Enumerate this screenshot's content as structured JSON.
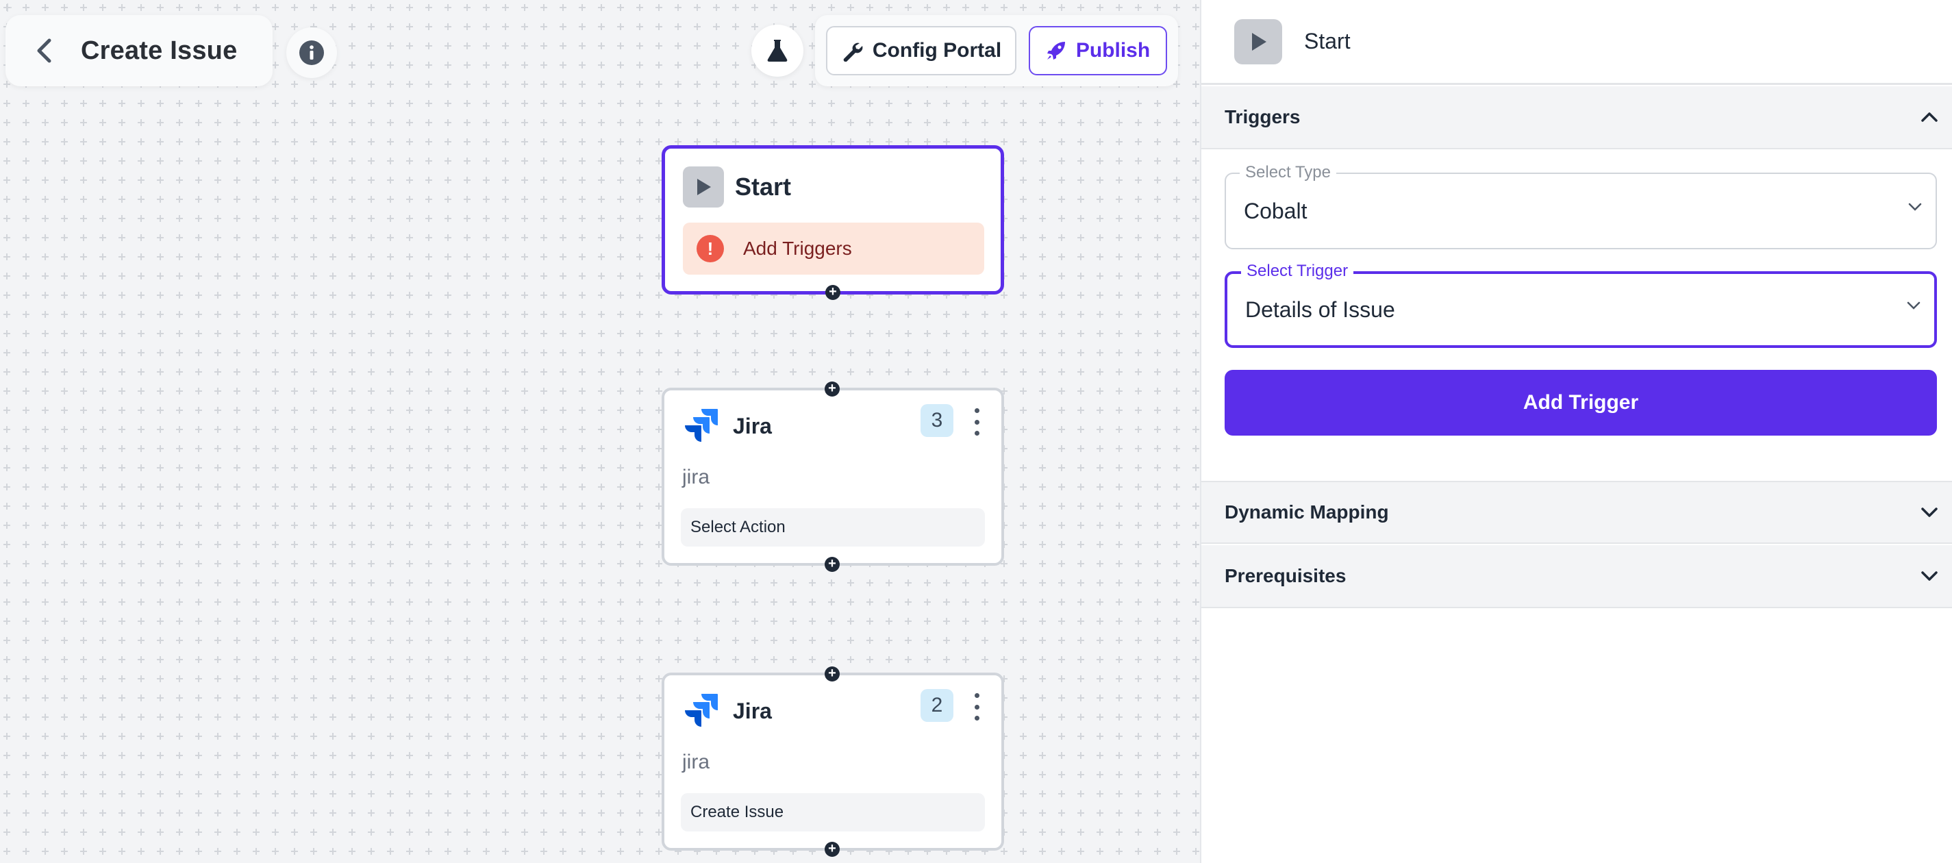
{
  "header": {
    "title": "Create Issue",
    "config_portal_label": "Config Portal",
    "publish_label": "Publish"
  },
  "icons": {
    "back": "chevron-left-icon",
    "info": "info-icon",
    "test": "flask-icon",
    "config": "wrench-icon",
    "publish": "rocket-icon"
  },
  "colors": {
    "accent": "#5b2eea",
    "warning_bg": "#fde6dc",
    "warning_icon": "#ee5a4a",
    "badge_bg": "#d3ecfa"
  },
  "nodes": {
    "start": {
      "title": "Start",
      "warning": "Add Triggers",
      "warning_icon_text": "!"
    },
    "jira1": {
      "title": "Jira",
      "subtitle": "jira",
      "count": "3",
      "action": "Select Action"
    },
    "jira2": {
      "title": "Jira",
      "subtitle": "jira",
      "count": "2",
      "action": "Create Issue"
    }
  },
  "panel": {
    "title": "Start",
    "sections": {
      "triggers": "Triggers",
      "dynamic_mapping": "Dynamic Mapping",
      "prerequisites": "Prerequisites"
    },
    "select_type": {
      "label": "Select Type",
      "value": "Cobalt"
    },
    "select_trigger": {
      "label": "Select Trigger",
      "value": "Details of Issue"
    },
    "add_trigger_label": "Add Trigger"
  }
}
